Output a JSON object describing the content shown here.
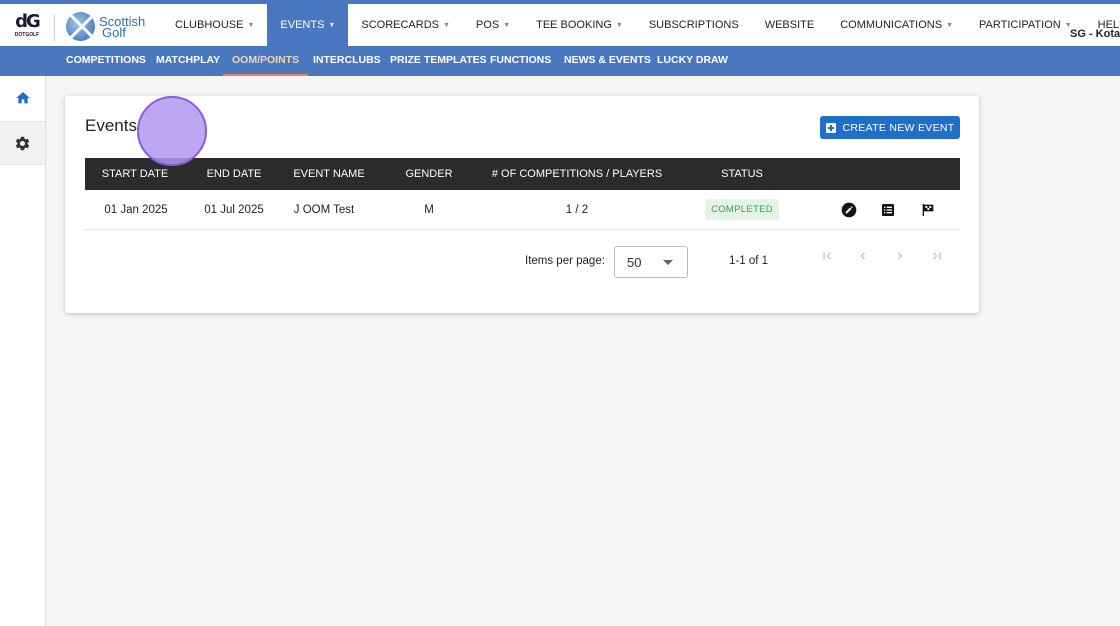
{
  "brand": {
    "dotgolf_mark": "dG",
    "dotgolf_text": "DOTGOLF",
    "scottish_line1": "Scottish",
    "scottish_line2": "Golf"
  },
  "nav": {
    "items": [
      {
        "label": "CLUBHOUSE",
        "caret": true
      },
      {
        "label": "EVENTS",
        "caret": true,
        "active": true
      },
      {
        "label": "SCORECARDS",
        "caret": true
      },
      {
        "label": "POS",
        "caret": true
      },
      {
        "label": "TEE BOOKING",
        "caret": true
      },
      {
        "label": "SUBSCRIPTIONS",
        "caret": false
      },
      {
        "label": "WEBSITE",
        "caret": false
      },
      {
        "label": "COMMUNICATIONS",
        "caret": true
      },
      {
        "label": "PARTICIPATION",
        "caret": true
      },
      {
        "label": "HELP",
        "caret": true
      }
    ],
    "user": "SG - Kotar"
  },
  "subnav": {
    "items": [
      "COMPETITIONS",
      "MATCHPLAY",
      "OOM/POINTS",
      "INTERCLUBS",
      "PRIZE TEMPLATES",
      "FUNCTIONS",
      "NEWS & EVENTS",
      "LUCKY DRAW"
    ],
    "active_index": 2
  },
  "sidebar": {
    "icons": [
      "home-icon",
      "gear-icon"
    ]
  },
  "events": {
    "title": "Events",
    "create_button": "CREATE NEW EVENT",
    "columns": [
      "START DATE",
      "END DATE",
      "EVENT NAME",
      "GENDER",
      "# OF COMPETITIONS / PLAYERS",
      "STATUS"
    ],
    "rows": [
      {
        "start": "01 Jan 2025",
        "end": "01 Jul 2025",
        "name": "J OOM Test",
        "gender": "M",
        "comps_players": "1 / 2",
        "status": "COMPLETED"
      }
    ],
    "actions": [
      "edit-icon",
      "list-icon",
      "flag-icon"
    ],
    "pager": {
      "label": "Items per page:",
      "per_page": "50",
      "range": "1-1 of 1"
    }
  },
  "colors": {
    "accent": "#4a78c0",
    "primary_button": "#1f6fc9",
    "header_row": "#2b2b2b",
    "status_completed_bg": "#e3f4e4",
    "status_completed_text": "#3c9a4a",
    "active_tab_underline": "#e8834a"
  }
}
